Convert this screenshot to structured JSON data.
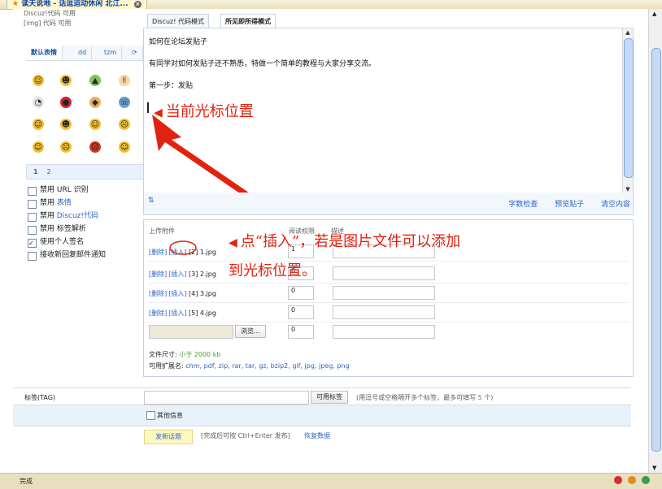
{
  "window": {
    "tab_title": "读天说地 - 话逗运动休闲 北江...",
    "close_icon": "close-icon",
    "status_text": "完成"
  },
  "left_panel": {
    "top_line_1": "Discuz!代码 可用",
    "top_line_2": "[img] 代码 可用",
    "tabs": [
      "默认表情",
      "dd",
      "tzm"
    ],
    "pages": [
      "1",
      "2"
    ],
    "options": [
      {
        "label": "禁用 URL 识别",
        "checked": false
      },
      {
        "label_prefix": "禁用 ",
        "label_link": "表情",
        "checked": false
      },
      {
        "label_prefix": "禁用 ",
        "label_link": "Discuz!代码",
        "checked": false
      },
      {
        "label": "禁用 标签解析",
        "checked": false
      },
      {
        "label": "使用个人签名",
        "checked": true
      },
      {
        "label": "接收新回复邮件通知",
        "checked": false
      }
    ]
  },
  "editor": {
    "mode_tabs": [
      "Discuz! 代码模式",
      "所见即所得模式"
    ],
    "lines": [
      "如何在论坛发贴子",
      "有同学对如何发贴子还不熟悉，特做一个简单的教程与大家分享交流。",
      "第一步：发贴"
    ],
    "cursor_annotation": "当前光标位置",
    "toolbar_actions": [
      "字数检查",
      "预览贴子",
      "清空内容"
    ]
  },
  "upload": {
    "header": "上传附件",
    "header_perm": "阅读权限",
    "header_desc": "描述",
    "rows": [
      {
        "delete": "[删除]",
        "insert": "[插入]",
        "name": "[2] 1.jpg",
        "perm": "1"
      },
      {
        "delete": "[删除]",
        "insert": "[插入]",
        "name": "[3] 2.jpg",
        "perm": "0"
      },
      {
        "delete": "[删除]",
        "insert": "[插入]",
        "name": "[4] 3.jpg",
        "perm": "0"
      },
      {
        "delete": "[删除]",
        "insert": "[插入]",
        "name": "[5] 4.jpg",
        "perm": "0"
      }
    ],
    "browse_label": "浏览...",
    "browse_perm": "0",
    "file_size_label": "文件尺寸:",
    "file_size_value": "小于 2000 kb",
    "ext_label": "可用扩展名:",
    "ext_value": "chm, pdf, zip, rar, tar, gz, bzip2, gif, jpg, jpeg, png",
    "annotation_line_1": "点“插入”，若是图片文件可以添加",
    "annotation_line_2": "到光标位置。"
  },
  "tag": {
    "label": "标签(TAG)",
    "button": "可用标签",
    "hint_prefix": "(用逗号或空格隔开多个标签，最多可填写",
    "hint_count": "5",
    "hint_suffix": "个)"
  },
  "other": {
    "label": "其他信息"
  },
  "submit": {
    "button": "发新话题",
    "hint": "[完成后可按 Ctrl+Enter 发布]",
    "restore": "恢复数据"
  },
  "colors": {
    "annotation_red": "#e3210f",
    "link_blue": "#2f64c4",
    "panel_blue": "#e9f2fb"
  }
}
